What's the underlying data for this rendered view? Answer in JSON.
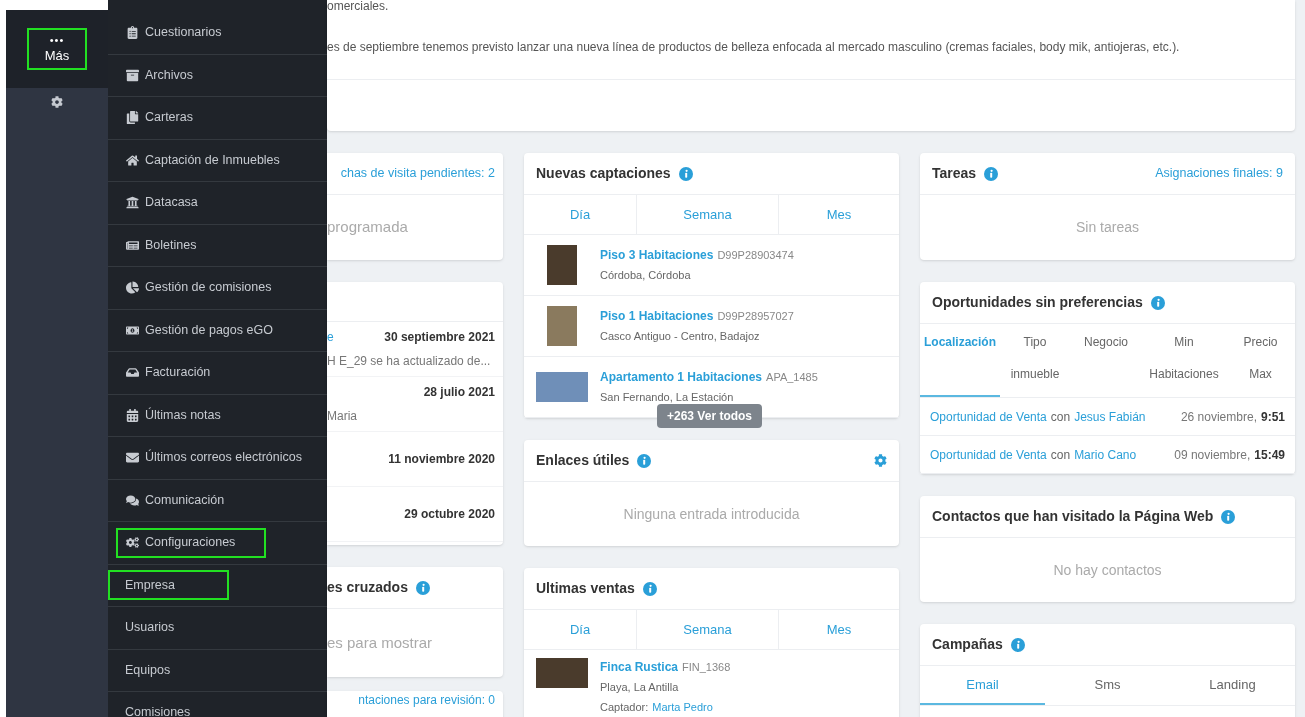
{
  "sidebar": {
    "more_button": {
      "dots": "•••",
      "label": "Más",
      "highlighted": true
    }
  },
  "menu": [
    {
      "kind": "main",
      "label": "Cuestionarios",
      "highlighted": false
    },
    {
      "kind": "main",
      "label": "Archivos",
      "highlighted": false
    },
    {
      "kind": "main",
      "label": "Carteras",
      "highlighted": false
    },
    {
      "kind": "main",
      "label": "Captación de Inmuebles",
      "highlighted": false
    },
    {
      "kind": "main",
      "label": "Datacasa",
      "highlighted": false
    },
    {
      "kind": "main",
      "label": "Boletines",
      "highlighted": false
    },
    {
      "kind": "main",
      "label": "Gestión de comisiones",
      "highlighted": false
    },
    {
      "kind": "main",
      "label": "Gestión de pagos eGO",
      "highlighted": false
    },
    {
      "kind": "main",
      "label": "Facturación",
      "highlighted": false
    },
    {
      "kind": "main",
      "label": "Últimas notas",
      "highlighted": false
    },
    {
      "kind": "main",
      "label": "Últimos correos electrónicos",
      "highlighted": false
    },
    {
      "kind": "main",
      "label": "Comunicación",
      "highlighted": false
    },
    {
      "kind": "main",
      "label": "Configuraciones",
      "highlighted": true
    },
    {
      "kind": "sub",
      "label": "Empresa",
      "highlighted": true
    },
    {
      "kind": "sub",
      "label": "Usuarios",
      "highlighted": false
    },
    {
      "kind": "sub",
      "label": "Equipos",
      "highlighted": false
    },
    {
      "kind": "sub",
      "label": "Comisiones",
      "highlighted": false
    }
  ],
  "notice": {
    "lines": [
      "omerciales.",
      "es de septiembre tenemos previsto lanzar una nueva línea de productos de belleza enfocada al mercado masculino (cremas faciales, body mik, antiojeras, etc.)."
    ]
  },
  "left_column": {
    "visits": {
      "link": "chas de visita pendientes: 2",
      "empty": "programada"
    },
    "updates": [
      {
        "link": "e",
        "date": "30 septiembre 2021",
        "text": "H E_29 se ha actualizado de..."
      },
      {
        "date": "28 julio 2021",
        "text": "Maria"
      },
      {
        "date": "11 noviembre 2020"
      },
      {
        "date": "29 octubre 2020"
      }
    ],
    "crossed": {
      "title": "es cruzados",
      "empty": "es para mostrar"
    },
    "review": {
      "link": "ntaciones para revisión: 0"
    }
  },
  "nuevas_captaciones": {
    "title": "Nuevas captaciones",
    "tabs": [
      "Día",
      "Semana",
      "Mes"
    ],
    "listings": [
      {
        "title": "Piso 3 Habitaciones",
        "ref": "D99P28903474",
        "place": "Córdoba, Córdoba"
      },
      {
        "title": "Piso 1 Habitaciones",
        "ref": "D99P28957027",
        "place": "Casco Antiguo - Centro, Badajoz"
      },
      {
        "title": "Apartamento 1 Habitaciones",
        "ref": "APA_1485",
        "place": "San Fernando, La Estación"
      }
    ],
    "more_button": "+263 Ver todos"
  },
  "enlaces": {
    "title": "Enlaces útiles",
    "empty": "Ninguna entrada introducida"
  },
  "ultimas_ventas": {
    "title": "Ultimas ventas",
    "tabs": [
      "Día",
      "Semana",
      "Mes"
    ],
    "listings": [
      {
        "title": "Finca Rustica",
        "ref": "FIN_1368",
        "place": "Playa, La Antilla",
        "agent_label": "Captador:",
        "agent": "Marta Pedro"
      }
    ]
  },
  "tareas": {
    "title": "Tareas",
    "link": "Asignaciones finales: 9",
    "empty": "Sin tareas"
  },
  "oportunidades": {
    "title": "Oportunidades sin preferencias",
    "columns": [
      {
        "lines": [
          "Localización"
        ],
        "selected": true
      },
      {
        "lines": [
          "Tipo",
          "inmueble"
        ],
        "selected": false
      },
      {
        "lines": [
          "Negocio"
        ],
        "selected": false
      },
      {
        "lines": [
          "Min",
          "Habitaciones"
        ],
        "selected": false
      },
      {
        "lines": [
          "Precio",
          "Max"
        ],
        "selected": false
      }
    ],
    "rows": [
      {
        "type": "Oportunidad de Venta",
        "with": "con",
        "contact": "Jesus Fabián",
        "date": "26 noviembre,",
        "time": "9:51"
      },
      {
        "type": "Oportunidad de Venta",
        "with": "con",
        "contact": "Mario Cano",
        "date": "09 noviembre,",
        "time": "15:49"
      }
    ]
  },
  "contactos_web": {
    "title": "Contactos que han visitado la Página Web",
    "empty": "No hay contactos"
  },
  "campanas": {
    "title": "Campañas",
    "tabs": [
      {
        "label": "Email",
        "selected": true
      },
      {
        "label": "Sms",
        "selected": false
      },
      {
        "label": "Landing",
        "selected": false
      }
    ]
  }
}
